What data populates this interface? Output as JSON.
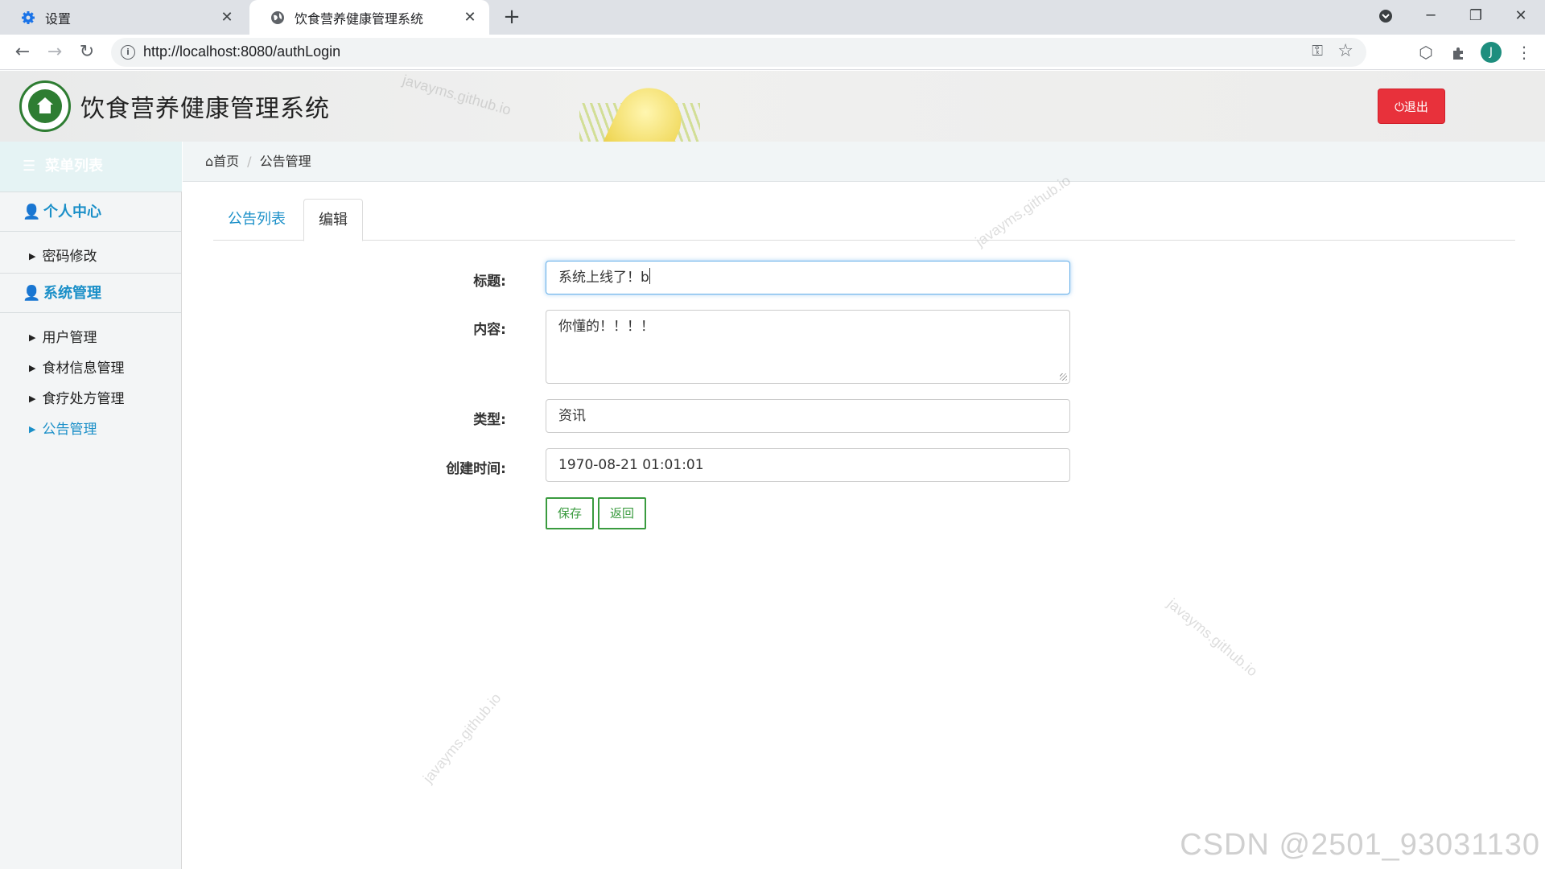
{
  "browser": {
    "tabs": [
      {
        "title": "设置",
        "icon": "gear-icon"
      },
      {
        "title": "饮食营养健康管理系统",
        "icon": "globe-icon"
      }
    ],
    "url": "http://localhost:8080/authLogin",
    "avatar_letter": "J"
  },
  "header": {
    "title": "饮食营养健康管理系统",
    "logout_label": "⏻退出",
    "watermark": "javayms.github.io"
  },
  "sidebar": {
    "title": "菜单列表",
    "groups": [
      {
        "label": "个人中心",
        "items": [
          "密码修改"
        ]
      },
      {
        "label": "系统管理",
        "items": [
          "用户管理",
          "食材信息管理",
          "食疗处方管理",
          "公告管理"
        ]
      }
    ],
    "active_item": "公告管理"
  },
  "breadcrumb": {
    "home": "首页",
    "current": "公告管理"
  },
  "tabs": {
    "list": "公告列表",
    "edit": "编辑"
  },
  "form": {
    "title_label": "标题:",
    "title_value": "系统上线了！b",
    "content_label": "内容:",
    "content_value": "你懂的！！！！",
    "type_label": "类型:",
    "type_value": "资讯",
    "time_label": "创建时间:",
    "time_value": "1970-08-21 01:01:01",
    "save_label": "保存",
    "back_label": "返回"
  },
  "footer_watermark": "CSDN @2501_93031130",
  "colors": {
    "accent": "#1a8fc8",
    "logout": "#e8313b",
    "button_green": "#3a9b3f"
  }
}
